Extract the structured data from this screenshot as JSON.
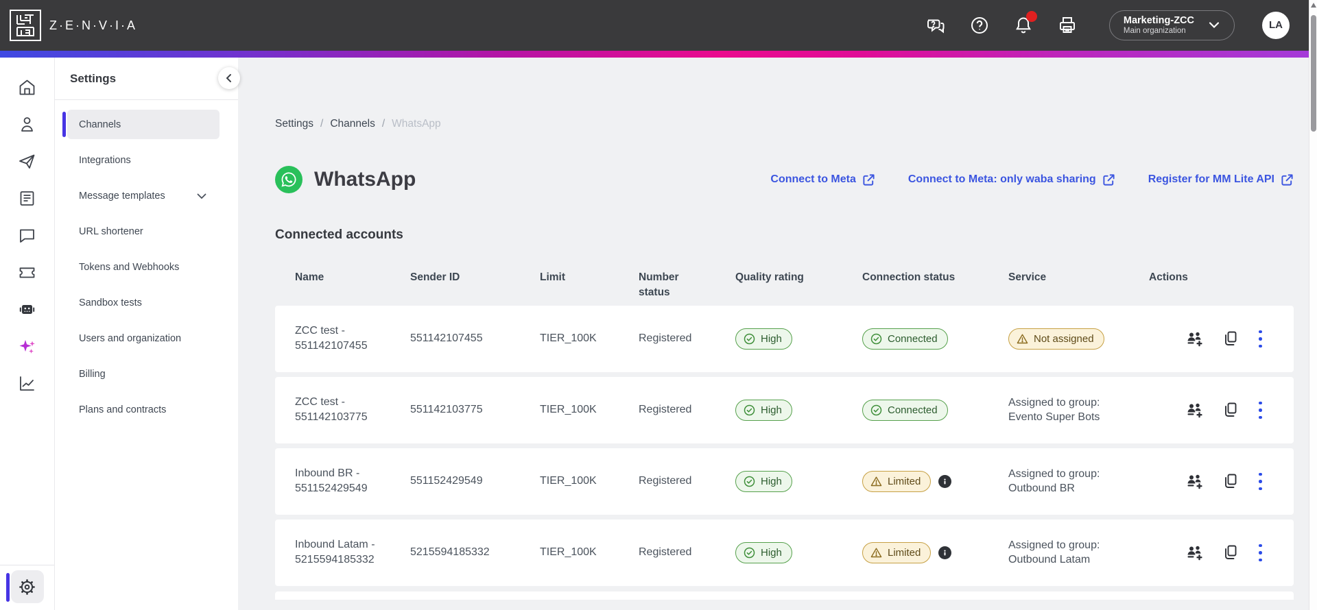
{
  "topbar": {
    "brand": "Z·E·N·V·I·A",
    "icons": [
      "chat-question-icon",
      "help-icon",
      "notifications-bell-icon",
      "printer-icon"
    ],
    "notifications_unread": true,
    "org": {
      "name": "Marketing-ZCC",
      "sub": "Main organization"
    },
    "avatar_initials": "LA"
  },
  "rail": {
    "icons": [
      "home-icon",
      "contacts-icon",
      "send-icon",
      "documents-icon",
      "chat-icon",
      "ticket-icon",
      "bot-icon",
      "ai-sparkles-icon",
      "analytics-icon",
      "gear-icon"
    ]
  },
  "sidebar": {
    "title": "Settings",
    "items": [
      {
        "label": "Channels",
        "selected": true
      },
      {
        "label": "Integrations",
        "selected": false
      },
      {
        "label": "Message templates",
        "selected": false,
        "has_chevron": true
      },
      {
        "label": "URL shortener",
        "selected": false
      },
      {
        "label": "Tokens and Webhooks",
        "selected": false
      },
      {
        "label": "Sandbox tests",
        "selected": false
      },
      {
        "label": "Users and organization",
        "selected": false
      },
      {
        "label": "Billing",
        "selected": false
      },
      {
        "label": "Plans and contracts",
        "selected": false
      }
    ]
  },
  "breadcrumb": {
    "separator": "/",
    "parts": [
      {
        "label": "Settings",
        "current": false
      },
      {
        "label": "Channels",
        "current": false
      },
      {
        "label": "WhatsApp",
        "current": true
      }
    ]
  },
  "page": {
    "title": "WhatsApp",
    "links": [
      {
        "label": "Connect to Meta"
      },
      {
        "label": "Connect to Meta: only waba sharing"
      },
      {
        "label": "Register for MM Lite API"
      }
    ],
    "section_title": "Connected accounts"
  },
  "table": {
    "columns": [
      "Name",
      "Sender ID",
      "Limit",
      "Number status",
      "Quality rating",
      "Connection status",
      "Service",
      "Actions"
    ],
    "rows": [
      {
        "name": "ZCC test - 551142107455",
        "sender_id": "551142107455",
        "limit": "TIER_100K",
        "number_status": "Registered",
        "quality": {
          "label": "High",
          "tone": "green"
        },
        "connection": {
          "label": "Connected",
          "tone": "green",
          "has_info": false
        },
        "service": {
          "type": "badge",
          "label": "Not assigned",
          "tone": "amber"
        }
      },
      {
        "name": "ZCC test - 551142103775",
        "sender_id": "551142103775",
        "limit": "TIER_100K",
        "number_status": "Registered",
        "quality": {
          "label": "High",
          "tone": "green"
        },
        "connection": {
          "label": "Connected",
          "tone": "green",
          "has_info": false
        },
        "service": {
          "type": "text",
          "line1": "Assigned to group:",
          "line2": "Evento Super Bots"
        }
      },
      {
        "name": "Inbound BR - 551152429549",
        "sender_id": "551152429549",
        "limit": "TIER_100K",
        "number_status": "Registered",
        "quality": {
          "label": "High",
          "tone": "green"
        },
        "connection": {
          "label": "Limited",
          "tone": "amber",
          "has_info": true
        },
        "service": {
          "type": "text",
          "line1": "Assigned to group:",
          "line2": "Outbound BR"
        }
      },
      {
        "name": "Inbound Latam - 5215594185332",
        "sender_id": "5215594185332",
        "limit": "TIER_100K",
        "number_status": "Registered",
        "quality": {
          "label": "High",
          "tone": "green"
        },
        "connection": {
          "label": "Limited",
          "tone": "amber",
          "has_info": true
        },
        "service": {
          "type": "text",
          "line1": "Assigned to group:",
          "line2": "Outbound Latam"
        }
      }
    ]
  },
  "colors": {
    "topbar_bg": "#3a3a3c",
    "accent_indigo": "#4634e4",
    "link_blue": "#3b55e0",
    "kebab_blue": "#2c4ce8",
    "whatsapp_green": "#29c05a",
    "status_green_border": "#55a04b",
    "status_green_bg": "#edf7eb",
    "status_amber_border": "#c6a044",
    "status_amber_bg": "#fbf2da",
    "gradient": [
      "#3f4ae2",
      "#ea0b8e",
      "#a43ad8"
    ],
    "content_bg": "#f0f1f3",
    "notification_dot": "#e02020"
  }
}
